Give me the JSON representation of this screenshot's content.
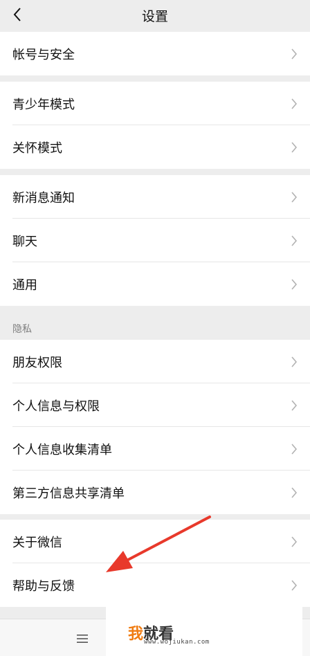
{
  "nav": {
    "title": "设置"
  },
  "groups": {
    "account": [
      "帐号与安全"
    ],
    "youth": [
      "青少年模式",
      "关怀模式"
    ],
    "general": [
      "新消息通知",
      "聊天",
      "通用"
    ],
    "privacy_title": "隐私",
    "privacy": [
      "朋友权限",
      "个人信息与权限",
      "个人信息收集清单",
      "第三方信息共享清单"
    ],
    "about": [
      "关于微信",
      "帮助与反馈"
    ]
  },
  "watermark": {
    "main_prefix": "我",
    "main_rest": "就看",
    "sub": "www.wojiukan.com"
  },
  "colors": {
    "arrow": "#e8392b",
    "watermark_accent": "#f07b10"
  },
  "icons": {
    "back": "back-chevron-icon",
    "row": "chevron-right-icon",
    "menu": "menu-icon"
  }
}
